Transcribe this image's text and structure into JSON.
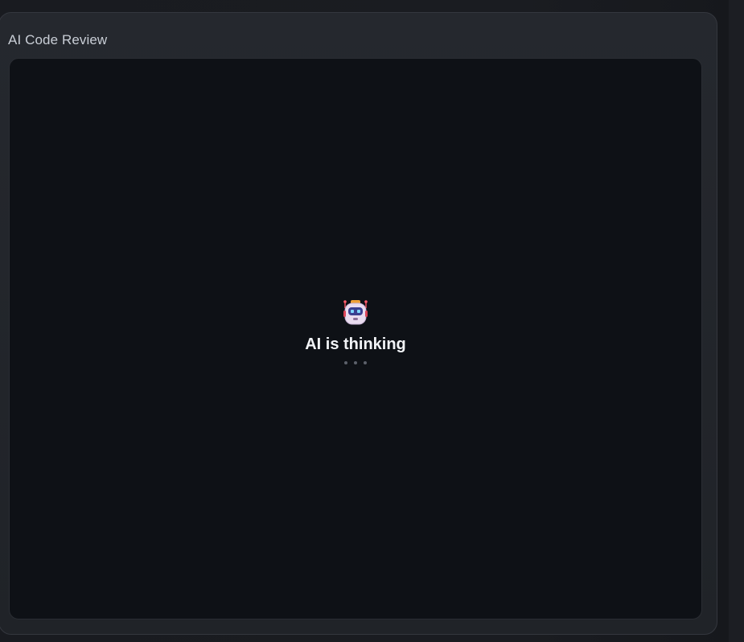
{
  "panel": {
    "title": "AI Code Review"
  },
  "status": {
    "icon": "robot-icon",
    "label": "AI is thinking",
    "loading_dots": 3
  },
  "colors": {
    "background": "#1a1c21",
    "panel": "#23262b",
    "content": "#0e1116",
    "text": "#f2f4f7",
    "title_text": "#c9ced6",
    "dot": "#5c616b"
  }
}
